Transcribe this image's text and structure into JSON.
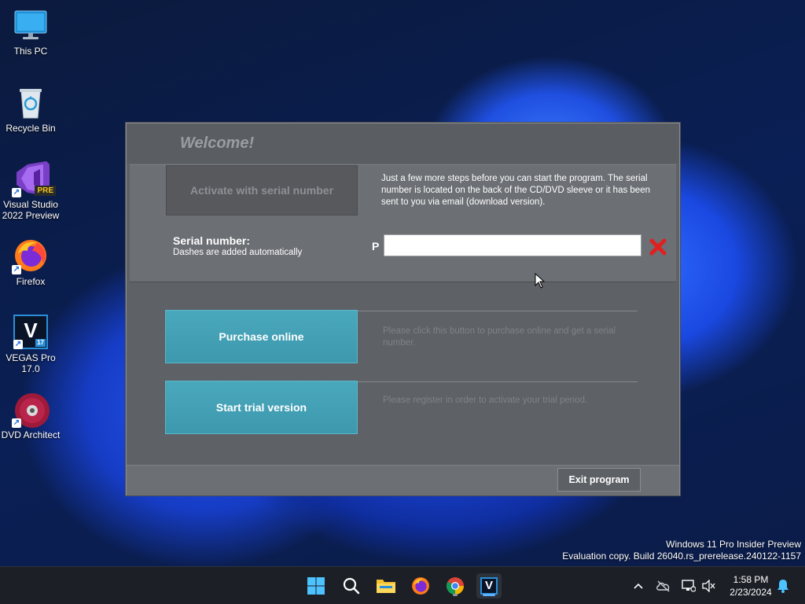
{
  "desktop": {
    "icons": [
      {
        "label": "This PC"
      },
      {
        "label": "Recycle Bin"
      },
      {
        "label": "Visual Studio 2022 Preview",
        "badge": "PRE"
      },
      {
        "label": "Firefox"
      },
      {
        "label": "VEGAS Pro 17.0",
        "glyph": "V",
        "badge": "17"
      },
      {
        "label": "DVD Architect"
      }
    ]
  },
  "dialog": {
    "title": "Welcome!",
    "activate_label": "Activate with serial number",
    "activate_description": "Just a few more steps before you can start the program. The serial number is located on the back of the CD/DVD sleeve or it has been sent to you via email (download version).",
    "serial_label": "Serial number:",
    "serial_sublabel": "Dashes are added automatically",
    "serial_prefix": "P",
    "serial_value": "",
    "purchase_label": "Purchase online",
    "purchase_description": "Please click this button to purchase online and get a serial number.",
    "trial_label": "Start trial version",
    "trial_description": "Please register in order to activate your trial period.",
    "exit_label": "Exit program"
  },
  "watermark": {
    "line1": "Windows 11 Pro Insider Preview",
    "line2": "Evaluation copy. Build 26040.rs_prerelease.240122-1157"
  },
  "taskbar": {
    "time": "1:58 PM",
    "date": "2/23/2024",
    "vegas_glyph": "V"
  },
  "colors": {
    "accent_teal": "#46a3b8",
    "dialog_bg": "#5e6166",
    "taskbar_bg": "#1c1f26"
  }
}
